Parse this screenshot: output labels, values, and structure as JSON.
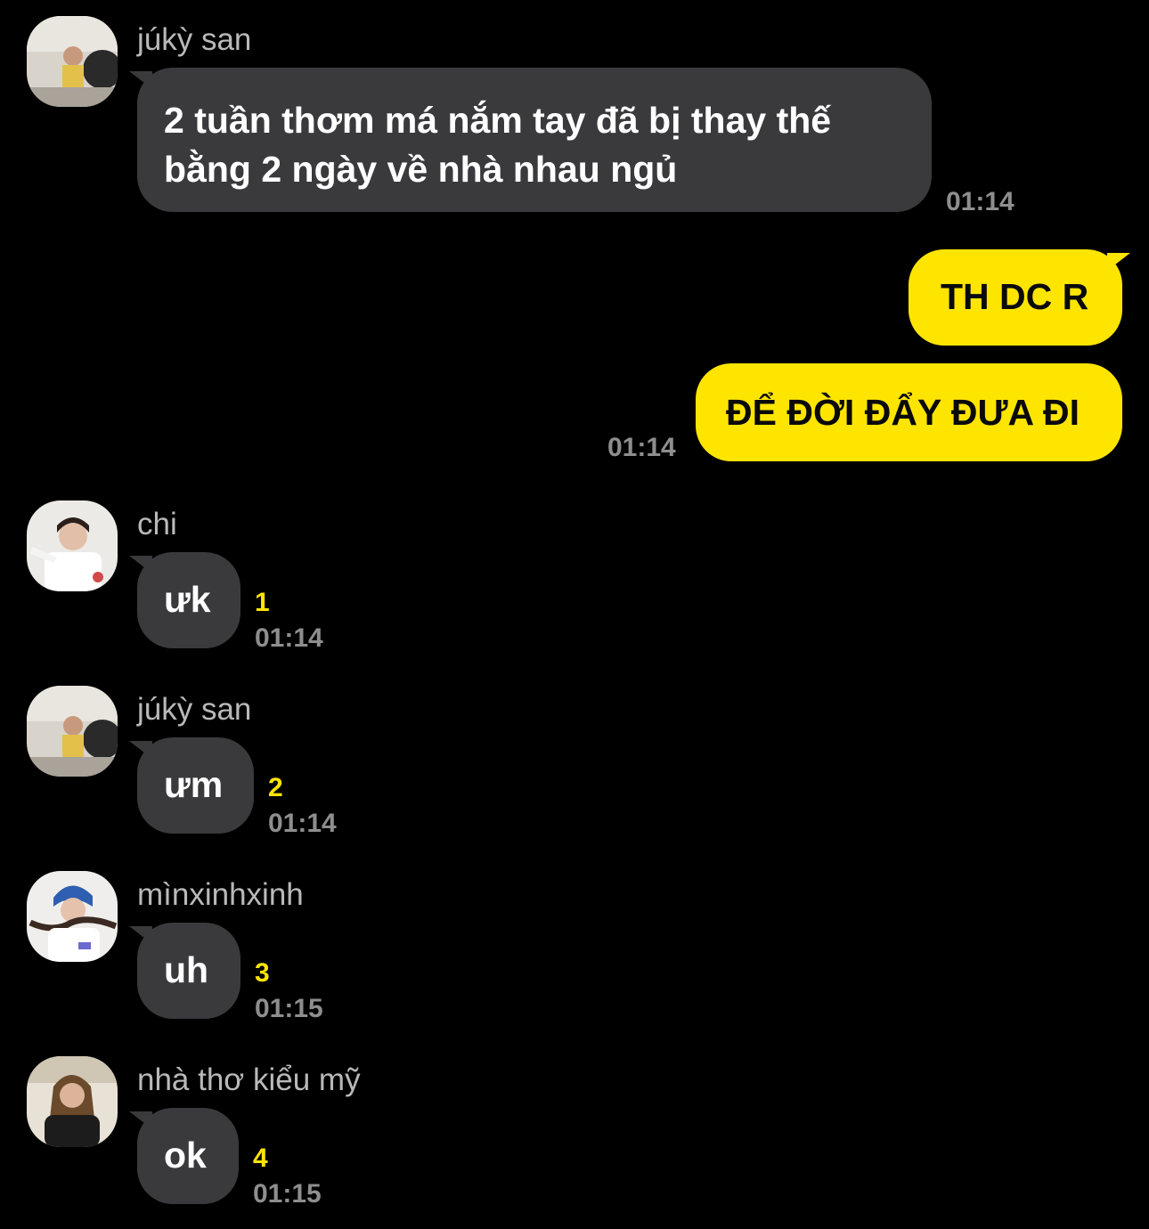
{
  "messages": [
    {
      "sender": "júkỳ san",
      "line1": "2 tuần thơm má nắm tay đã bị thay thế",
      "line2": "bằng 2 ngày về nhà nhau ngủ",
      "time": "01:14"
    },
    {
      "text": "TH DC R"
    },
    {
      "text": "ĐỂ ĐỜI ĐẨY ĐƯA ĐI",
      "time": "01:14"
    },
    {
      "sender": "chi",
      "text": "ưk",
      "unread": "1",
      "time": "01:14"
    },
    {
      "sender": "júkỳ san",
      "text": "ưm",
      "unread": "2",
      "time": "01:14"
    },
    {
      "sender": "mìnxinhxinh",
      "text": "uh",
      "unread": "3",
      "time": "01:15"
    },
    {
      "sender": "nhà thơ kiểu mỹ",
      "text": "ok",
      "unread": "4",
      "time": "01:15"
    }
  ],
  "colors": {
    "background": "#000000",
    "incoming_bubble": "#3a3a3c",
    "outgoing_bubble": "#fee500",
    "unread_count": "#fee500",
    "timestamp": "#8e8e8e"
  },
  "icons": [
    "avatar-photo"
  ]
}
